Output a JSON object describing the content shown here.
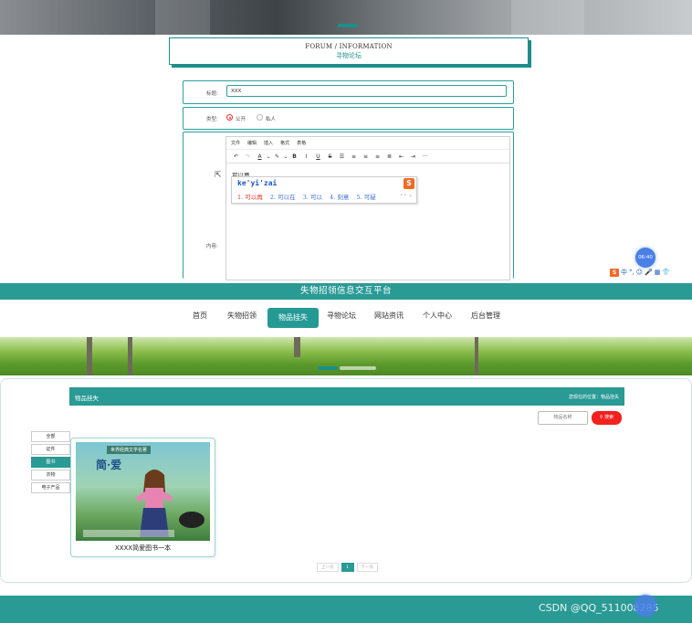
{
  "forum": {
    "title_en": "FORUM / INFORMATION",
    "title_cn": "寻物论坛",
    "title_label": "标题:",
    "title_value": "XXX",
    "type_label": "类型:",
    "type_options": [
      "公开",
      "私人"
    ],
    "type_selected": "公开",
    "content_label": "内容:",
    "editor_menu": [
      "文件",
      "编辑",
      "插入",
      "格式",
      "表格"
    ],
    "editor_text": "可以再",
    "toolbar_more": "···"
  },
  "ime": {
    "pinyin": "ke'yi'zai",
    "candidates": [
      "1. 可以再",
      "2. 可以在",
      "3. 可以",
      "4. 刻意",
      "5. 可疑"
    ],
    "clock": "06:40",
    "status_items": [
      "中",
      "°,",
      "☺",
      "🎤",
      "▦",
      "👕"
    ]
  },
  "site": {
    "header_title": "失物招领信息交互平台",
    "nav": [
      {
        "label": "首页"
      },
      {
        "label": "失物招领"
      },
      {
        "label": "物品挂失"
      },
      {
        "label": "寻物论坛"
      },
      {
        "label": "网站资讯"
      },
      {
        "label": "个人中心"
      },
      {
        "label": "后台管理"
      }
    ],
    "nav_active": "物品挂失"
  },
  "section": {
    "title": "物品挂失",
    "breadcrumb": "您现在的位置：物品挂失",
    "search_placeholder": "物品名称",
    "search_button": "搜索"
  },
  "categories": [
    "全部",
    "证件",
    "图书",
    "衣物",
    "电子产品"
  ],
  "category_active": "图书",
  "products": [
    {
      "name": "XXXX简爱图书一本",
      "cover_title": "简·爱",
      "cover_series": "世界经典文学名著"
    }
  ],
  "pagination": {
    "prev": "上一页",
    "current": "1",
    "next": "下一页"
  },
  "footer": {
    "watermark": "CSDN @QQ_511008285"
  },
  "colors": {
    "brand": "#2a9a95",
    "search": "#f1211e",
    "ime_orange": "#f36a25",
    "link_blue": "#3d6fd6"
  }
}
